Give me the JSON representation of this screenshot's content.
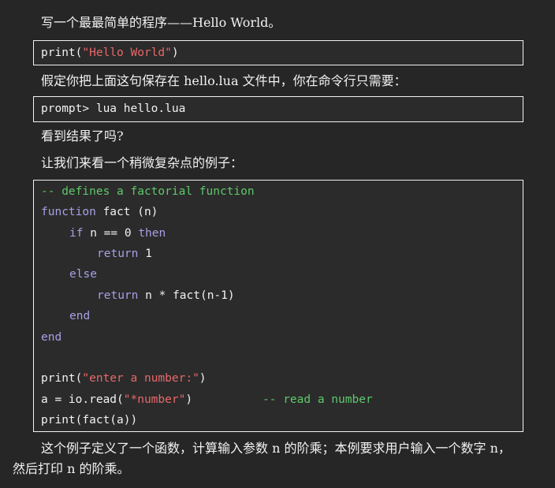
{
  "intro": "写一个最最简单的程序——Hello World。",
  "hello_code": {
    "func": "print(",
    "str": "\"Hello World\"",
    "close": ")"
  },
  "save_text": "假定你把上面这句保存在 hello.lua 文件中，你在命令行只需要：",
  "prompt_code": "prompt> lua hello.lua",
  "see_result": "看到结果了吗?",
  "complex_intro": "让我们来看一个稍微复杂点的例子：",
  "factorial_code": {
    "comment_top": "-- defines a factorial function",
    "kw_function": "function",
    "fact_sig": " fact (n)",
    "kw_if": "if",
    "if_cond": " n == 0 ",
    "kw_then": "then",
    "kw_return1": "return",
    "return1_val": " 1",
    "kw_else": "else",
    "kw_return2": "return",
    "return2_val": " n * fact(n-1)",
    "kw_end_inner": "end",
    "kw_end_outer": "end",
    "print_func": "print(",
    "print_str": "\"enter a number:\"",
    "print_close": ")",
    "read_pre": "a = io.read(",
    "read_str": "\"*number\"",
    "read_close": ")",
    "read_comment": "-- read a number",
    "last_line": "print(fact(a))"
  },
  "explanation": {
    "line1": "这个例子定义了一个函数，计算输入参数 n 的阶乘；本例要求用户输入一个数字 n，",
    "line2": "然后打印 n 的阶乘。"
  },
  "colors": {
    "string": "#e8686a",
    "keyword": "#a7a0e6",
    "comment": "#5fc86b",
    "text": "#f2f2f2",
    "background": "#262626"
  }
}
